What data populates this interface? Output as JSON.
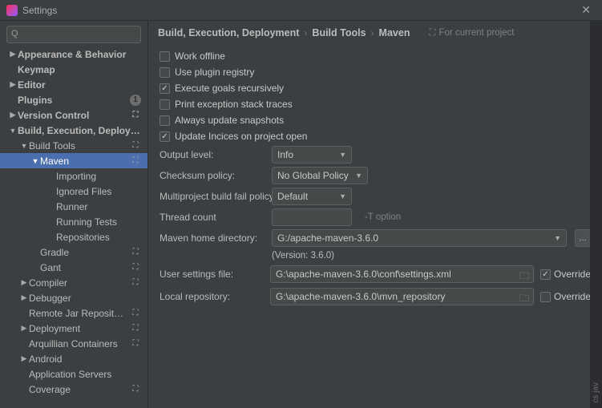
{
  "window": {
    "title": "Settings"
  },
  "search": {
    "placeholder": ""
  },
  "sidebar": [
    {
      "label": "Appearance & Behavior",
      "depth": 0,
      "arrow": "▶",
      "bold": true
    },
    {
      "label": "Keymap",
      "depth": 0,
      "bold": true
    },
    {
      "label": "Editor",
      "depth": 0,
      "arrow": "▶",
      "bold": true
    },
    {
      "label": "Plugins",
      "depth": 0,
      "bold": true,
      "badgeNum": "1"
    },
    {
      "label": "Version Control",
      "depth": 0,
      "arrow": "▶",
      "bold": true,
      "tag": "⛶"
    },
    {
      "label": "Build, Execution, Deployment",
      "depth": 0,
      "arrow": "▼",
      "bold": true
    },
    {
      "label": "Build Tools",
      "depth": 1,
      "arrow": "▼",
      "tag": "⛶"
    },
    {
      "label": "Maven",
      "depth": 2,
      "arrow": "▼",
      "tag": "⛶",
      "selected": true
    },
    {
      "label": "Importing",
      "depth": 3
    },
    {
      "label": "Ignored Files",
      "depth": 3
    },
    {
      "label": "Runner",
      "depth": 3
    },
    {
      "label": "Running Tests",
      "depth": 3
    },
    {
      "label": "Repositories",
      "depth": 3
    },
    {
      "label": "Gradle",
      "depth": 2,
      "tag": "⛶"
    },
    {
      "label": "Gant",
      "depth": 2,
      "tag": "⛶"
    },
    {
      "label": "Compiler",
      "depth": 1,
      "arrow": "▶",
      "tag": "⛶"
    },
    {
      "label": "Debugger",
      "depth": 1,
      "arrow": "▶"
    },
    {
      "label": "Remote Jar Repositories",
      "depth": 1,
      "tag": "⛶"
    },
    {
      "label": "Deployment",
      "depth": 1,
      "arrow": "▶",
      "tag": "⛶"
    },
    {
      "label": "Arquillian Containers",
      "depth": 1,
      "tag": "⛶"
    },
    {
      "label": "Android",
      "depth": 1,
      "arrow": "▶"
    },
    {
      "label": "Application Servers",
      "depth": 1
    },
    {
      "label": "Coverage",
      "depth": 1,
      "tag": "⛶"
    }
  ],
  "breadcrumb": {
    "a": "Build, Execution, Deployment",
    "b": "Build Tools",
    "c": "Maven",
    "scope": "For current project"
  },
  "checks": {
    "workOffline": {
      "label": "Work offline",
      "checked": false
    },
    "usePlugin": {
      "label": "Use plugin registry",
      "checked": false
    },
    "execGoals": {
      "label": "Execute goals recursively",
      "checked": true
    },
    "printStack": {
      "label": "Print exception stack traces",
      "checked": false
    },
    "alwaysUpd": {
      "label": "Always update snapshots",
      "checked": false
    },
    "updInd": {
      "label": "Update Incices on project open",
      "checked": true
    }
  },
  "fields": {
    "outputLevel": {
      "label": "Output level:",
      "value": "Info"
    },
    "checksum": {
      "label": "Checksum policy:",
      "value": "No Global Policy"
    },
    "multiFail": {
      "label": "Multiproject build fail policy:",
      "value": "Default"
    },
    "threadCount": {
      "label": "Thread count",
      "value": "",
      "hint": "-T option"
    },
    "mavenHome": {
      "label": "Maven home directory:",
      "value": "G:/apache-maven-3.6.0"
    },
    "versionNote": "(Version: 3.6.0)",
    "userSettings": {
      "label": "User settings file:",
      "value": "G:\\apache-maven-3.6.0\\conf\\settings.xml",
      "override": true,
      "overrideLabel": "Override"
    },
    "localRepo": {
      "label": "Local repository:",
      "value": "G:\\apache-maven-3.6.0\\mvn_repository",
      "override": false,
      "overrideLabel": "Override"
    }
  },
  "rightEdge": "cs   jav"
}
